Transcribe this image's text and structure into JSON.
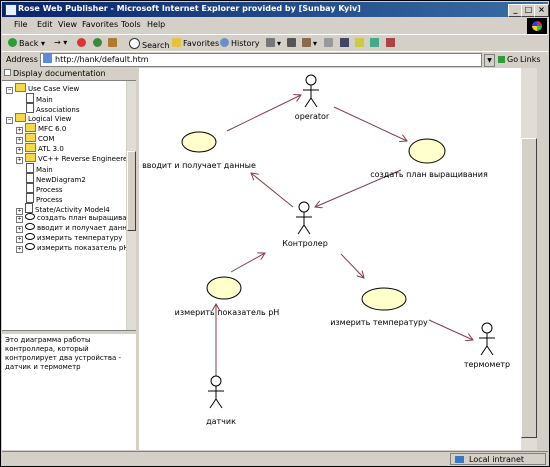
{
  "window": {
    "title": "Rose Web Publisher - Microsoft Internet Explorer provided by [Sunbay Kyiv]",
    "controls": [
      "_",
      "□",
      "×"
    ]
  },
  "menu": [
    "File",
    "Edit",
    "View",
    "Favorites",
    "Tools",
    "Help"
  ],
  "toolbar": {
    "back": "Back",
    "forward_arrow": "→",
    "search": "Search",
    "favorites": "Favorites",
    "history": "History"
  },
  "address": {
    "label": "Address",
    "url": "http://hank/default.htm",
    "go": "Go",
    "links": "Links"
  },
  "left_pane": {
    "header": "Display documentation",
    "tree": [
      {
        "label": "Use Case View",
        "icon": "folder-icon",
        "toggle": "−"
      },
      {
        "label": "Main",
        "icon": "diagram-icon"
      },
      {
        "label": "Associations",
        "icon": "doc-icon"
      },
      {
        "label": "Logical View",
        "icon": "folder-icon",
        "toggle": "−"
      },
      {
        "label": "MFC 6.0",
        "icon": "folder-icon",
        "toggle": "+"
      },
      {
        "label": "COM",
        "icon": "folder-icon",
        "toggle": "+"
      },
      {
        "label": "ATL 3.0",
        "icon": "folder-icon",
        "toggle": "+"
      },
      {
        "label": "VC++ Reverse Engineered",
        "icon": "folder-icon",
        "toggle": "+"
      },
      {
        "label": "Main",
        "icon": "diagram-icon"
      },
      {
        "label": "NewDiagram2",
        "icon": "diagram-icon"
      },
      {
        "label": "Process",
        "icon": "doc-icon"
      },
      {
        "label": "Process",
        "icon": "doc-icon"
      },
      {
        "label": "State/Activity Model4",
        "icon": "state-icon",
        "toggle": "+"
      },
      {
        "label": "создать план выращивания",
        "icon": "usecase-icon",
        "toggle": "+"
      },
      {
        "label": "вводит и получает данные",
        "icon": "usecase-icon",
        "toggle": "+"
      },
      {
        "label": "измерить температуру",
        "icon": "usecase-icon",
        "toggle": "+"
      },
      {
        "label": "измерить показатель pH",
        "icon": "usecase-icon",
        "toggle": "+"
      }
    ],
    "description": "Это диаграмма работы контроллера, который контролирует два устройства - датчик и термометр"
  },
  "diagram": {
    "actors": [
      {
        "id": "operator",
        "label": "operator"
      },
      {
        "id": "controller",
        "label": "Контролер"
      },
      {
        "id": "sensor",
        "label": "датчик"
      },
      {
        "id": "thermometer",
        "label": "термометр"
      }
    ],
    "use_cases": [
      {
        "id": "uc_data",
        "label": "вводит и получает данные"
      },
      {
        "id": "uc_plan",
        "label": "создать план выращивания"
      },
      {
        "id": "uc_ph",
        "label": "измерить показатель pH"
      },
      {
        "id": "uc_temp",
        "label": "измерить температуру"
      }
    ],
    "colors": {
      "usecase_fill": "#ffffcc",
      "arrow": "#8a3a4a"
    }
  },
  "status": {
    "zone": "Local intranet"
  }
}
